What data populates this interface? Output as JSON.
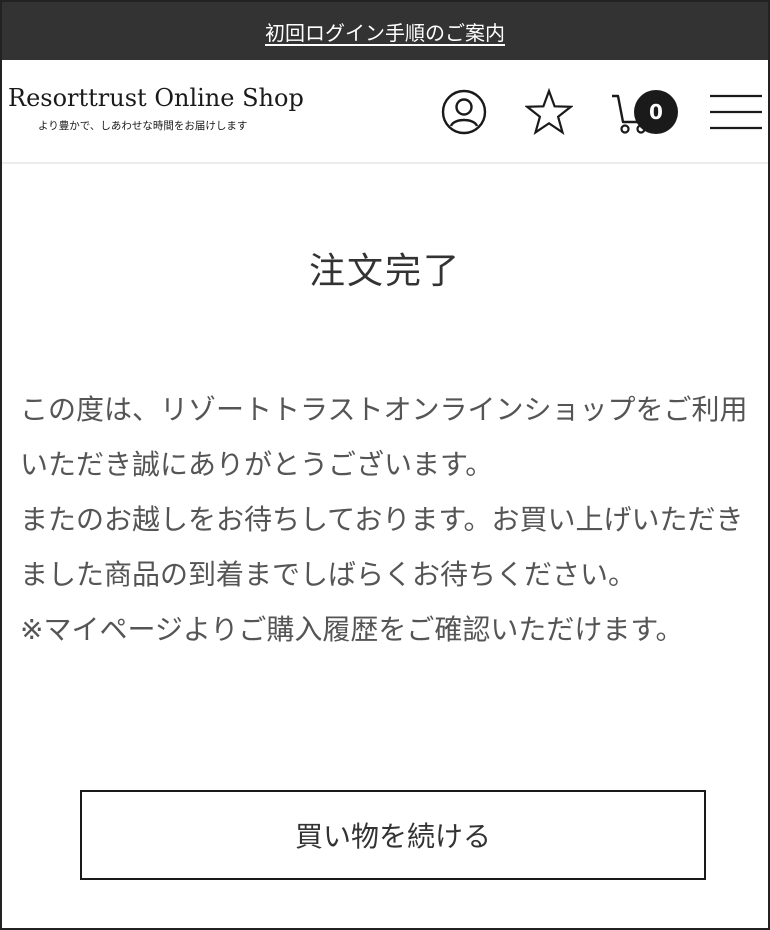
{
  "banner": {
    "link_text": "初回ログイン手順のご案内"
  },
  "header": {
    "logo_text": "Resorttrust Online Shop",
    "logo_tagline": "より豊かで、しあわせな時間をお届けします",
    "icons": [
      "user-icon",
      "star-icon",
      "cart-icon",
      "menu-icon"
    ],
    "cart_count": "0"
  },
  "main": {
    "title": "注文完了",
    "message_lines": [
      "この度は、リゾートトラストオンラインショップをご利用いただき誠にありがとうございます。",
      "またのお越しをお待ちしております。お買い上げいただきました商品の到着までしばらくお待ちください。",
      "※マイページよりご購入履歴をご確認いただけます。"
    ],
    "continue_button": "買い物を続ける"
  },
  "colors": {
    "banner_bg": "#333333",
    "text": "#333333",
    "badge_bg": "#1a1a1a"
  }
}
